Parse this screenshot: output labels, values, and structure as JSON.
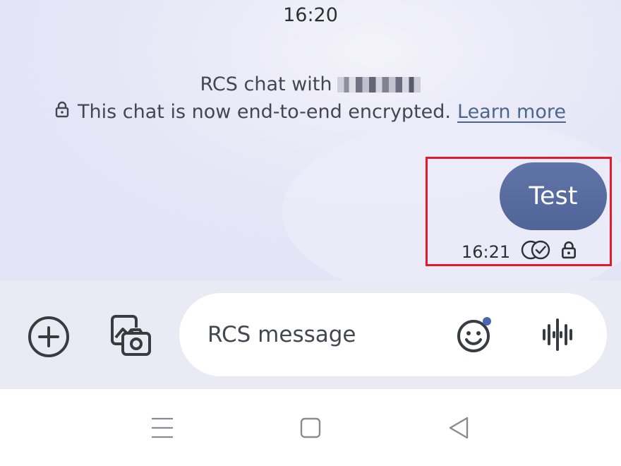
{
  "chat": {
    "header_time": "16:20",
    "rcs_intro": "RCS chat with",
    "encryption_notice": "This chat is now end-to-end encrypted.",
    "learn_more_label": "Learn more"
  },
  "message": {
    "text": "Test",
    "time": "16:21",
    "status_icon": "double-check-icon",
    "encrypted_icon": "lock-icon"
  },
  "composer": {
    "placeholder": "RCS message",
    "add_icon": "plus-circle-icon",
    "gallery_icon": "gallery-camera-icon",
    "emoji_icon": "emoji-icon",
    "voice_icon": "voice-waveform-icon"
  },
  "navigation": {
    "menu_icon": "menu-icon",
    "home_icon": "home-icon",
    "back_icon": "back-icon"
  },
  "colors": {
    "bubble": "#5a6ea3",
    "link": "#4a6790",
    "highlight": "#e21a2c",
    "emoji_badge": "#4a67b0"
  }
}
